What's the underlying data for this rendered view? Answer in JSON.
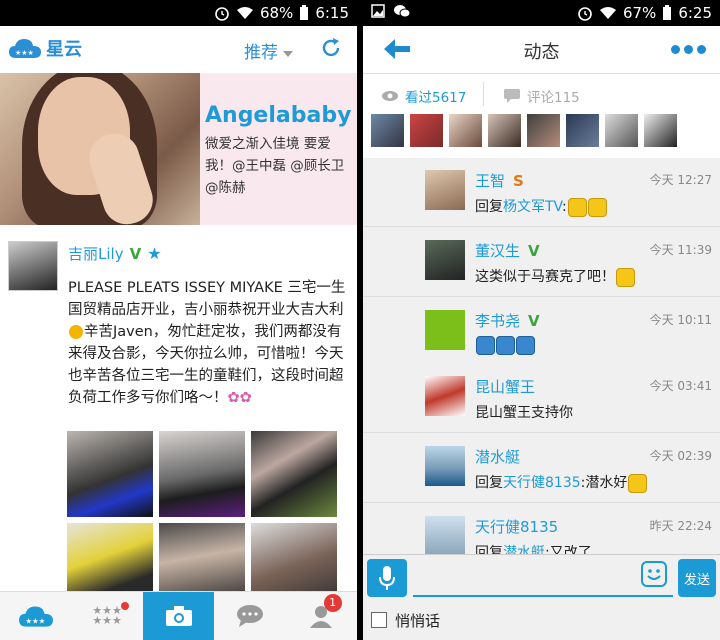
{
  "left": {
    "status": {
      "battery": "68%",
      "time": "6:15"
    },
    "app_name": "星云",
    "recommend_label": "推荐",
    "banner": {
      "name": "Angelababy",
      "text": "微爱之渐入佳境 要爱我！@王中磊 @顾长卫 @陈赫"
    },
    "post": {
      "author": "吉丽Lily",
      "verified": "V",
      "text_1": "PLEASE PLEATS ISSEY MIYAKE 三宅一生国贸精品店开业，吉小丽恭祝开业大吉大利",
      "text_2": "辛苦Javen，匆忙赶定妆，我们两都没有来得及合影，今天你拉么帅，可惜啦！今天也辛苦各位三宅一生的童鞋们，这段时间超负荷工作多亏你们咯～！"
    },
    "nav": {
      "profile_badge": "1"
    },
    "icons": [
      "cloud-logo-icon",
      "dropdown-arrow-icon",
      "refresh-icon",
      "stars-icon",
      "camera-icon",
      "chat-icon",
      "person-icon"
    ]
  },
  "right": {
    "status": {
      "battery": "67%",
      "time": "6:25"
    },
    "title": "动态",
    "views": "看过5617",
    "comments_count": "评论115",
    "comments": [
      {
        "name": "王智",
        "badge": "S",
        "time": "今天 12:27",
        "prefix": "回复",
        "reply_to": "杨文军TV",
        "text": ":"
      },
      {
        "name": "董汉生",
        "badge": "V",
        "time": "今天 11:39",
        "prefix": "",
        "reply_to": "",
        "text": "这类似于马赛克了吧！"
      },
      {
        "name": "李书尧",
        "badge": "V",
        "time": "今天 10:11",
        "prefix": "",
        "reply_to": "",
        "text": ""
      },
      {
        "name": "昆山蟹王",
        "badge": "",
        "time": "今天 03:41",
        "prefix": "",
        "reply_to": "",
        "text": "昆山蟹王支持你"
      },
      {
        "name": "潜水艇",
        "badge": "",
        "time": "今天 02:39",
        "prefix": "回复",
        "reply_to": "天行健8135",
        "text": ":潜水好"
      },
      {
        "name": "天行健8135",
        "badge": "",
        "time": "昨天 22:24",
        "prefix": "回复",
        "reply_to": "潜水艇",
        "text": ":又改了"
      }
    ],
    "send_label": "发送",
    "whisper_label": "悄悄话"
  },
  "colors": {
    "accent": "#1c9ad6",
    "link": "#1e9bd7",
    "verified": "#3ba53b",
    "badge_red": "#e53935"
  }
}
